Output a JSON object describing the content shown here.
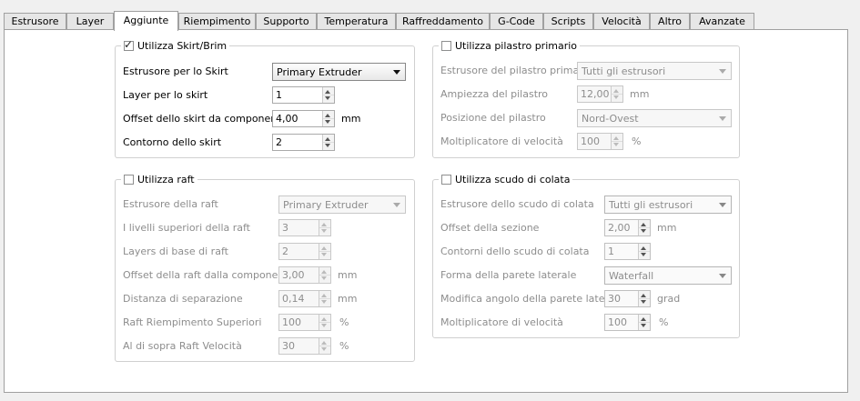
{
  "tabs": [
    "Estrusore",
    "Layer",
    "Aggiunte",
    "Riempimento",
    "Supporto",
    "Temperatura",
    "Raffreddamento",
    "G-Code",
    "Scripts",
    "Velocità",
    "Altro",
    "Avanzate"
  ],
  "active_tab": "Aggiunte",
  "skirt": {
    "title": "Utilizza Skirt/Brim",
    "checked": true,
    "extruder_label": "Estrusore per lo Skirt",
    "extruder_value": "Primary Extruder",
    "layers_label": "Layer per lo skirt",
    "layers_value": "1",
    "offset_label": "Offset dello skirt da componente",
    "offset_value": "4,00",
    "offset_unit": "mm",
    "outlines_label": "Contorno dello skirt",
    "outlines_value": "2"
  },
  "raft": {
    "title": "Utilizza raft",
    "checked": false,
    "extruder_label": "Estrusore della raft",
    "extruder_value": "Primary Extruder",
    "top_layers_label": "I livelli superiori della raft",
    "top_layers_value": "3",
    "base_layers_label": "Layers di base di raft",
    "base_layers_value": "2",
    "offset_label": "Offset della raft dalla componente",
    "offset_value": "3,00",
    "offset_unit": "mm",
    "separation_label": "Distanza di separazione",
    "separation_value": "0,14",
    "separation_unit": "mm",
    "top_infill_label": "Raft Riempimento Superiori",
    "top_infill_value": "100",
    "top_infill_unit": "%",
    "above_speed_label": "Al di sopra Raft Velocità",
    "above_speed_value": "30",
    "above_speed_unit": "%"
  },
  "prime_pillar": {
    "title": "Utilizza pilastro primario",
    "checked": false,
    "extruder_label": "Estrusore del pilastro primario",
    "extruder_value": "Tutti gli estrusori",
    "width_label": "Ampiezza del pilastro",
    "width_value": "12,00",
    "width_unit": "mm",
    "position_label": "Posizione del pilastro",
    "position_value": "Nord-Ovest",
    "speed_label": "Moltiplicatore di velocità",
    "speed_value": "100",
    "speed_unit": "%"
  },
  "ooze_shield": {
    "title": "Utilizza scudo di colata",
    "checked": false,
    "extruder_label": "Estrusore dello scudo di colata",
    "extruder_value": "Tutti gli estrusori",
    "offset_label": "Offset della sezione",
    "offset_value": "2,00",
    "offset_unit": "mm",
    "outlines_label": "Contorni dello scudo di colata",
    "outlines_value": "1",
    "sidewall_label": "Forma della parete laterale",
    "sidewall_value": "Waterfall",
    "angle_label": "Modifica angolo della parete laterale",
    "angle_value": "30",
    "angle_unit": "grad",
    "speed_label": "Moltiplicatore di velocità",
    "speed_value": "100",
    "speed_unit": "%"
  }
}
